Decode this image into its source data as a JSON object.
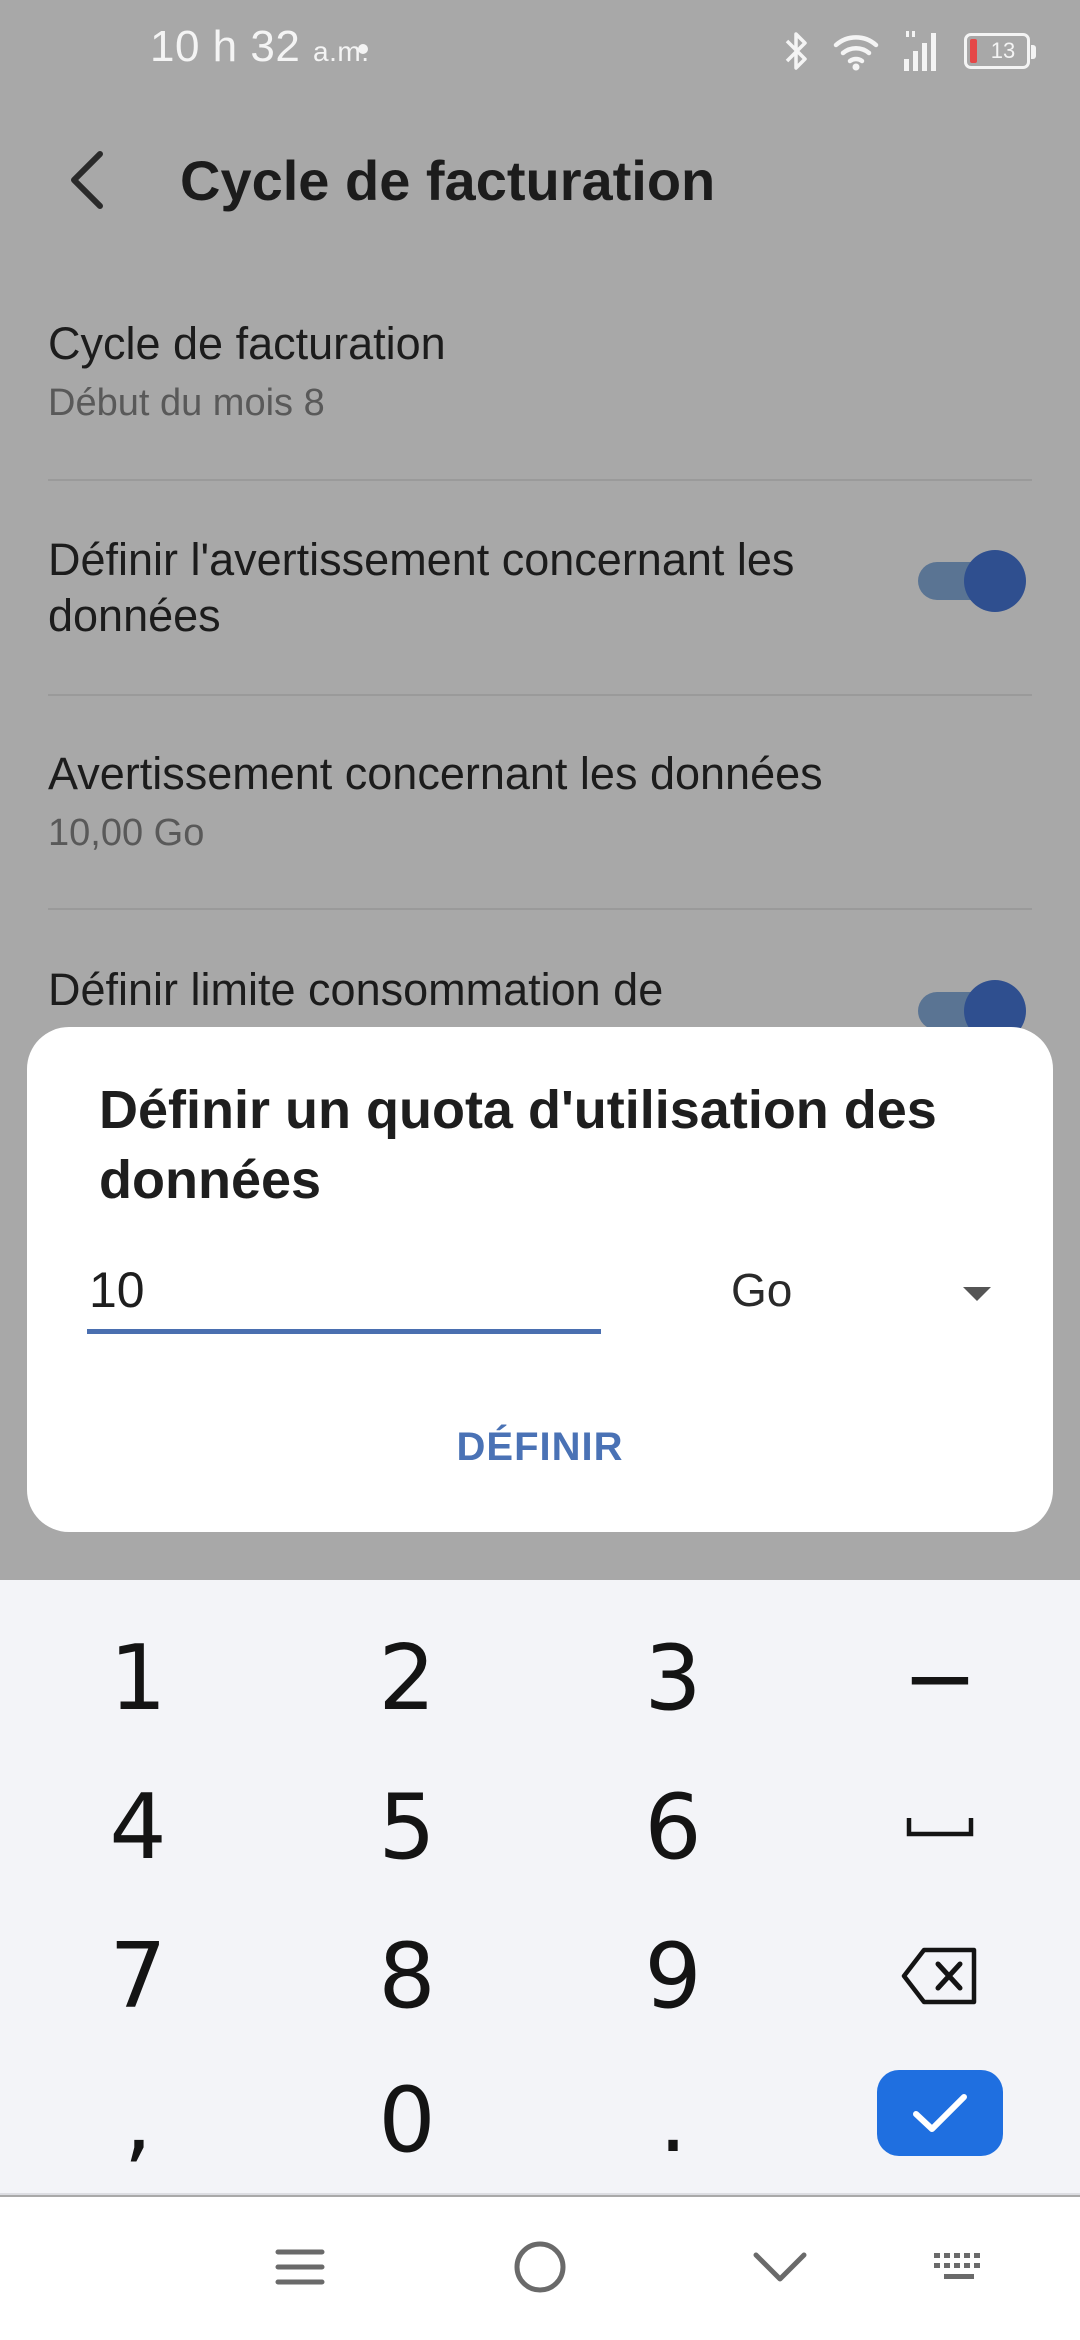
{
  "status_bar": {
    "time": "10 h 32",
    "ampm": "a.m.",
    "battery_level": "13",
    "icons": [
      "bluetooth-icon",
      "wifi-icon",
      "signal-icon",
      "battery-icon"
    ]
  },
  "appbar": {
    "title": "Cycle de facturation",
    "back_icon": "back-arrow-icon"
  },
  "settings": {
    "billing_cycle": {
      "title": "Cycle de facturation",
      "subtitle": "Début du mois 8"
    },
    "set_data_warning": {
      "title": "Définir l'avertissement concernant les données",
      "enabled": true
    },
    "data_warning": {
      "title": "Avertissement concernant les données",
      "subtitle": "10,00 Go"
    },
    "set_data_limit": {
      "title": "Définir limite consommation de",
      "enabled": true
    }
  },
  "dialog": {
    "title": "Définir un quota d'utilisation des données",
    "input_value": "10",
    "unit_selected": "Go",
    "confirm_label": "DÉFINIR"
  },
  "keyboard": {
    "keys": [
      [
        "1",
        "2",
        "3",
        "−"
      ],
      [
        "4",
        "5",
        "6",
        "space"
      ],
      [
        "7",
        "8",
        "9",
        "backspace"
      ],
      [
        ",",
        "0",
        ".",
        "confirm"
      ]
    ]
  },
  "navbar": {
    "buttons": [
      "menu-icon",
      "home-icon",
      "collapse-keyboard-icon",
      "keyboard-switch-icon"
    ]
  },
  "colors": {
    "accent": "#4a72b5",
    "confirm_key": "#1f6fe0",
    "toggle_on": "#2f4f8f",
    "scrim_background": "#a8a8a8",
    "battery_low": "#e54848"
  }
}
